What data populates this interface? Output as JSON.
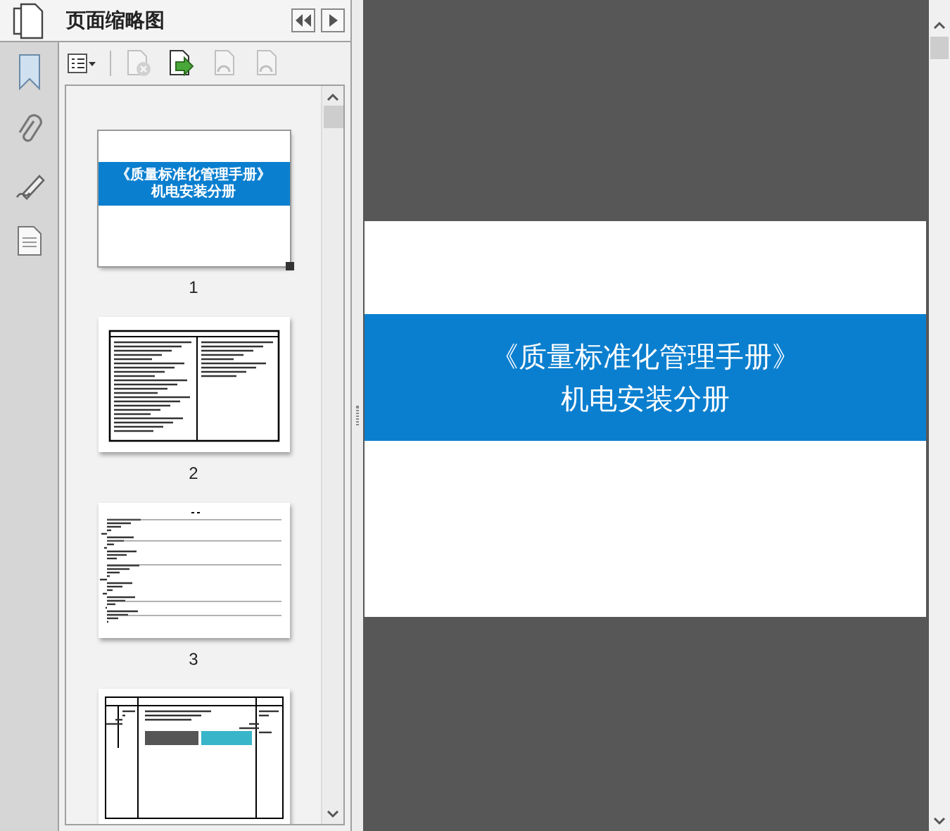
{
  "panel": {
    "title": "页面缩略图"
  },
  "toolbar": [
    {
      "kind": "options",
      "disabled": false
    },
    {
      "kind": "delete",
      "disabled": true
    },
    {
      "kind": "insert",
      "disabled": false
    },
    {
      "kind": "rotate-left",
      "disabled": true
    },
    {
      "kind": "rotate-right",
      "disabled": true
    }
  ],
  "thumbnails": [
    {
      "page": "1",
      "kind": "cover",
      "title": "《质量标准化管理手册》",
      "subtitle": "机电安装分册",
      "selected": true
    },
    {
      "page": "2",
      "kind": "two-column",
      "selected": false
    },
    {
      "page": "3",
      "kind": "contents",
      "selected": false
    },
    {
      "kind": "table",
      "selected": false
    }
  ],
  "document_page": {
    "title": "《质量标准化管理手册》",
    "subtitle": "机电安装分册"
  }
}
